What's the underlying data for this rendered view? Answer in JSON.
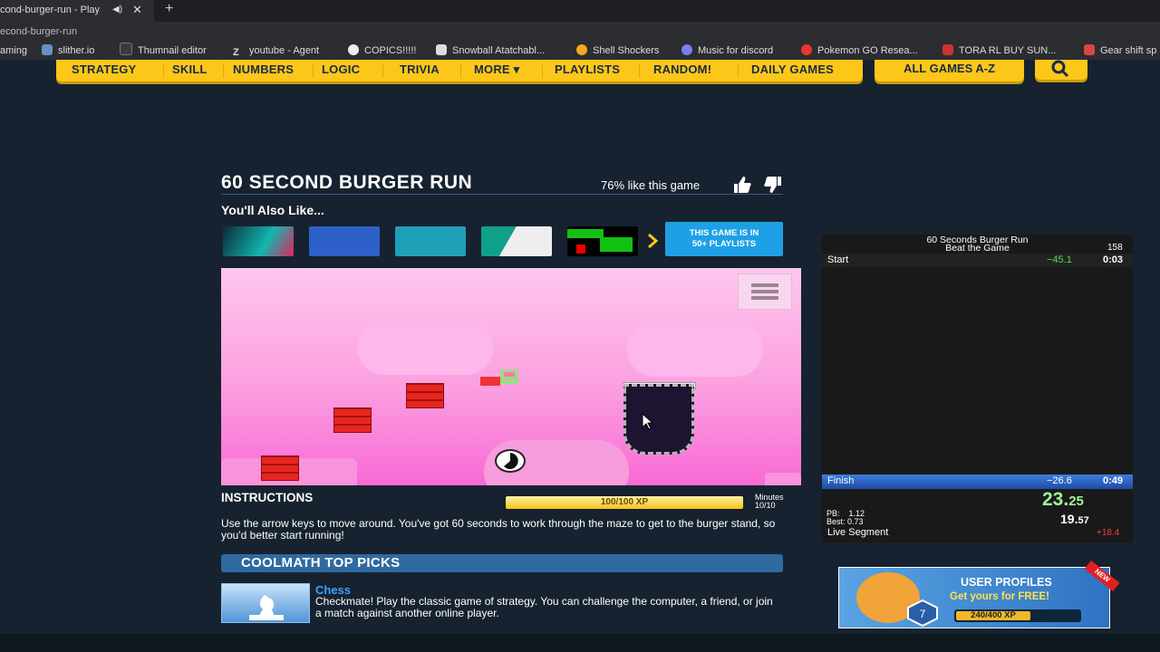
{
  "browser": {
    "tab_title": "cond-burger-run - Play",
    "audio_icon": "◀)",
    "close_glyph": "✕",
    "newtab_glyph": "+",
    "url_text": "econd-burger-run",
    "bookmarks": [
      "aming",
      "slither.io",
      "Thumnail editor",
      "youtube - Agent",
      "COPICS!!!!!",
      "Snowball Atatchabl...",
      "Shell Shockers",
      "Music for discord",
      "Pokemon GO Resea...",
      "TORA RL BUY SUN...",
      "Gear shift sp"
    ]
  },
  "nav": {
    "items": [
      "STRATEGY",
      "SKILL",
      "NUMBERS",
      "LOGIC",
      "TRIVIA",
      "MORE ▾",
      "PLAYLISTS",
      "RANDOM!",
      "DAILY GAMES"
    ],
    "all_games": "ALL GAMES A-Z",
    "search_icon": "search-icon"
  },
  "game_page": {
    "title": "60 SECOND BURGER RUN",
    "likes_text": "76% like this game",
    "also_like": "You'll Also Like...",
    "playlist_btn_line1": "THIS GAME IS IN",
    "playlist_btn_line2": "50+ PLAYLISTS",
    "instructions_heading": "INSTRUCTIONS",
    "xp_text": "100/100 XP",
    "xp_fraction": 1.0,
    "minutes_label": "Minutes",
    "minutes_value": "10/10",
    "instructions_text": "Use the arrow keys to move around. You've got 60 seconds to work through the maze to get to the burger stand, so you'd better start running!",
    "top_picks_heading": "COOLMATH TOP PICKS",
    "pick_title": "Chess",
    "pick_desc": "Checkmate! Play the classic game of strategy. You can challenge the computer, a friend, or join a match against another online player."
  },
  "livesplit": {
    "game": "60 Seconds Burger Run",
    "category": "Beat the Game",
    "attempts": "158",
    "start_label": "Start",
    "start_delta": "−45.1",
    "start_time": "0:03",
    "finish_label": "Finish",
    "finish_delta": "−26.6",
    "finish_time": "0:49",
    "timer_main": "23.",
    "timer_ms": "25",
    "segment_main": "19.",
    "segment_ms": "57",
    "pb_label": "PB:",
    "pb_value": "1.12",
    "best_label": "Best:",
    "best_value": "0.73",
    "live_segment_label": "Live Segment",
    "live_segment_delta": "+18.4"
  },
  "ad": {
    "line1": "USER PROFILES",
    "line2": "Get yours for FREE!",
    "xp_text": "240/400 XP",
    "xp_fraction": 0.6,
    "new_badge": "NEW"
  }
}
